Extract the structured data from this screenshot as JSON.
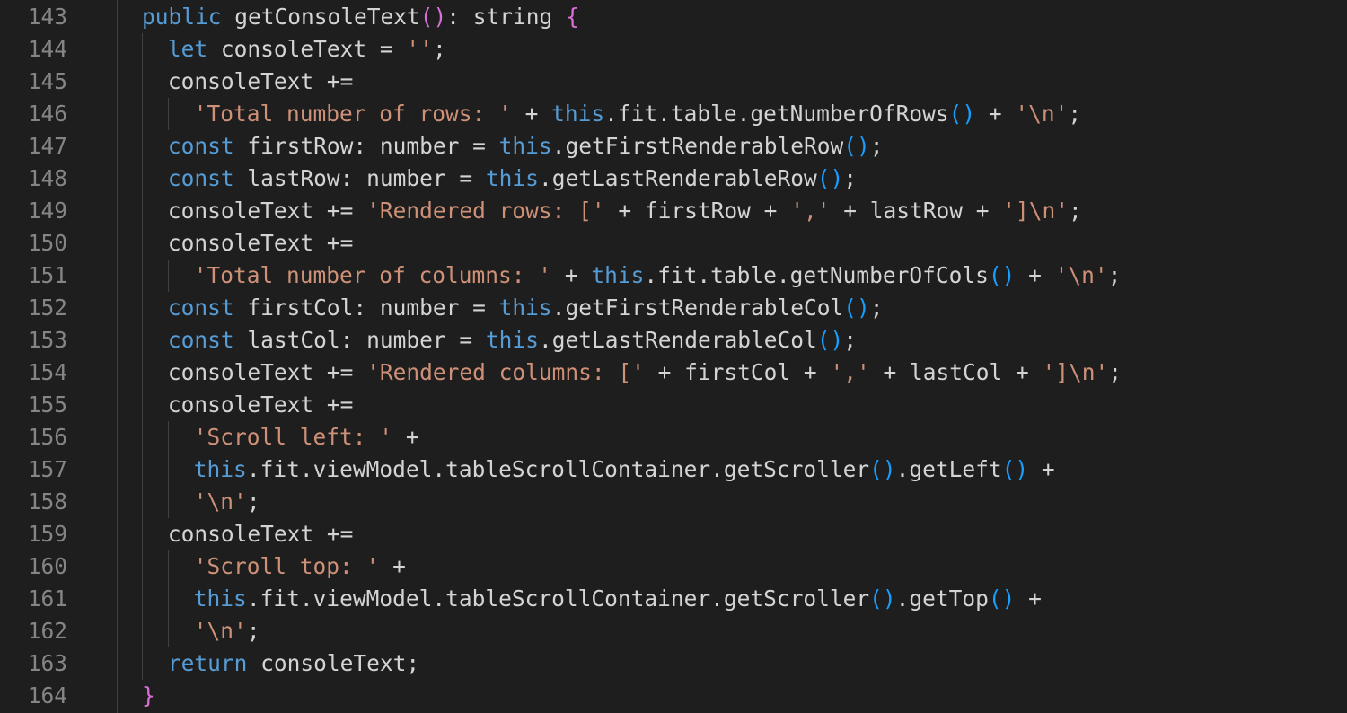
{
  "editor": {
    "language": "typescript",
    "colors": {
      "background": "#1e1e1e",
      "line_number": "#858585",
      "keyword": "#569cd6",
      "string": "#ce9178",
      "text": "#d4d4d4",
      "bracket_level1": "#da70d6",
      "bracket_level2": "#179fff",
      "indent_guide": "#404040"
    },
    "lines": [
      {
        "number": "143",
        "indent": 0,
        "tokens": [
          {
            "t": "public",
            "c": "kw"
          },
          {
            "t": " getConsoleText",
            "c": "plain"
          },
          {
            "t": "()",
            "c": "br1"
          },
          {
            "t": ": string ",
            "c": "plain"
          },
          {
            "t": "{",
            "c": "br1"
          }
        ]
      },
      {
        "number": "144",
        "indent": 1,
        "tokens": [
          {
            "t": "let",
            "c": "kw"
          },
          {
            "t": " consoleText = ",
            "c": "plain"
          },
          {
            "t": "''",
            "c": "str"
          },
          {
            "t": ";",
            "c": "plain"
          }
        ]
      },
      {
        "number": "145",
        "indent": 1,
        "tokens": [
          {
            "t": "consoleText +=",
            "c": "plain"
          }
        ]
      },
      {
        "number": "146",
        "indent": 2,
        "tokens": [
          {
            "t": "'Total number of rows: '",
            "c": "str"
          },
          {
            "t": " + ",
            "c": "plain"
          },
          {
            "t": "this",
            "c": "kw"
          },
          {
            "t": ".fit.table.getNumberOfRows",
            "c": "plain"
          },
          {
            "t": "()",
            "c": "br2"
          },
          {
            "t": " + ",
            "c": "plain"
          },
          {
            "t": "'\\n'",
            "c": "str"
          },
          {
            "t": ";",
            "c": "plain"
          }
        ]
      },
      {
        "number": "147",
        "indent": 1,
        "tokens": [
          {
            "t": "const",
            "c": "kw"
          },
          {
            "t": " firstRow: number = ",
            "c": "plain"
          },
          {
            "t": "this",
            "c": "kw"
          },
          {
            "t": ".getFirstRenderableRow",
            "c": "plain"
          },
          {
            "t": "()",
            "c": "br2"
          },
          {
            "t": ";",
            "c": "plain"
          }
        ]
      },
      {
        "number": "148",
        "indent": 1,
        "tokens": [
          {
            "t": "const",
            "c": "kw"
          },
          {
            "t": " lastRow: number = ",
            "c": "plain"
          },
          {
            "t": "this",
            "c": "kw"
          },
          {
            "t": ".getLastRenderableRow",
            "c": "plain"
          },
          {
            "t": "()",
            "c": "br2"
          },
          {
            "t": ";",
            "c": "plain"
          }
        ]
      },
      {
        "number": "149",
        "indent": 1,
        "tokens": [
          {
            "t": "consoleText += ",
            "c": "plain"
          },
          {
            "t": "'Rendered rows: ['",
            "c": "str"
          },
          {
            "t": " + firstRow + ",
            "c": "plain"
          },
          {
            "t": "','",
            "c": "str"
          },
          {
            "t": " + lastRow + ",
            "c": "plain"
          },
          {
            "t": "']\\n'",
            "c": "str"
          },
          {
            "t": ";",
            "c": "plain"
          }
        ]
      },
      {
        "number": "150",
        "indent": 1,
        "tokens": [
          {
            "t": "consoleText +=",
            "c": "plain"
          }
        ]
      },
      {
        "number": "151",
        "indent": 2,
        "tokens": [
          {
            "t": "'Total number of columns: '",
            "c": "str"
          },
          {
            "t": " + ",
            "c": "plain"
          },
          {
            "t": "this",
            "c": "kw"
          },
          {
            "t": ".fit.table.getNumberOfCols",
            "c": "plain"
          },
          {
            "t": "()",
            "c": "br2"
          },
          {
            "t": " + ",
            "c": "plain"
          },
          {
            "t": "'\\n'",
            "c": "str"
          },
          {
            "t": ";",
            "c": "plain"
          }
        ]
      },
      {
        "number": "152",
        "indent": 1,
        "tokens": [
          {
            "t": "const",
            "c": "kw"
          },
          {
            "t": " firstCol: number = ",
            "c": "plain"
          },
          {
            "t": "this",
            "c": "kw"
          },
          {
            "t": ".getFirstRenderableCol",
            "c": "plain"
          },
          {
            "t": "()",
            "c": "br2"
          },
          {
            "t": ";",
            "c": "plain"
          }
        ]
      },
      {
        "number": "153",
        "indent": 1,
        "tokens": [
          {
            "t": "const",
            "c": "kw"
          },
          {
            "t": " lastCol: number = ",
            "c": "plain"
          },
          {
            "t": "this",
            "c": "kw"
          },
          {
            "t": ".getLastRenderableCol",
            "c": "plain"
          },
          {
            "t": "()",
            "c": "br2"
          },
          {
            "t": ";",
            "c": "plain"
          }
        ]
      },
      {
        "number": "154",
        "indent": 1,
        "tokens": [
          {
            "t": "consoleText += ",
            "c": "plain"
          },
          {
            "t": "'Rendered columns: ['",
            "c": "str"
          },
          {
            "t": " + firstCol + ",
            "c": "plain"
          },
          {
            "t": "','",
            "c": "str"
          },
          {
            "t": " + lastCol + ",
            "c": "plain"
          },
          {
            "t": "']\\n'",
            "c": "str"
          },
          {
            "t": ";",
            "c": "plain"
          }
        ]
      },
      {
        "number": "155",
        "indent": 1,
        "tokens": [
          {
            "t": "consoleText +=",
            "c": "plain"
          }
        ]
      },
      {
        "number": "156",
        "indent": 2,
        "tokens": [
          {
            "t": "'Scroll left: '",
            "c": "str"
          },
          {
            "t": " +",
            "c": "plain"
          }
        ]
      },
      {
        "number": "157",
        "indent": 2,
        "tokens": [
          {
            "t": "this",
            "c": "kw"
          },
          {
            "t": ".fit.viewModel.tableScrollContainer.getScroller",
            "c": "plain"
          },
          {
            "t": "()",
            "c": "br2"
          },
          {
            "t": ".getLeft",
            "c": "plain"
          },
          {
            "t": "()",
            "c": "br2"
          },
          {
            "t": " +",
            "c": "plain"
          }
        ]
      },
      {
        "number": "158",
        "indent": 2,
        "tokens": [
          {
            "t": "'\\n'",
            "c": "str"
          },
          {
            "t": ";",
            "c": "plain"
          }
        ]
      },
      {
        "number": "159",
        "indent": 1,
        "tokens": [
          {
            "t": "consoleText +=",
            "c": "plain"
          }
        ]
      },
      {
        "number": "160",
        "indent": 2,
        "tokens": [
          {
            "t": "'Scroll top: '",
            "c": "str"
          },
          {
            "t": " +",
            "c": "plain"
          }
        ]
      },
      {
        "number": "161",
        "indent": 2,
        "tokens": [
          {
            "t": "this",
            "c": "kw"
          },
          {
            "t": ".fit.viewModel.tableScrollContainer.getScroller",
            "c": "plain"
          },
          {
            "t": "()",
            "c": "br2"
          },
          {
            "t": ".getTop",
            "c": "plain"
          },
          {
            "t": "()",
            "c": "br2"
          },
          {
            "t": " +",
            "c": "plain"
          }
        ]
      },
      {
        "number": "162",
        "indent": 2,
        "tokens": [
          {
            "t": "'\\n'",
            "c": "str"
          },
          {
            "t": ";",
            "c": "plain"
          }
        ]
      },
      {
        "number": "163",
        "indent": 1,
        "tokens": [
          {
            "t": "return",
            "c": "kw"
          },
          {
            "t": " consoleText;",
            "c": "plain"
          }
        ]
      },
      {
        "number": "164",
        "indent": 0,
        "tokens": [
          {
            "t": "}",
            "c": "br1"
          }
        ]
      }
    ]
  }
}
